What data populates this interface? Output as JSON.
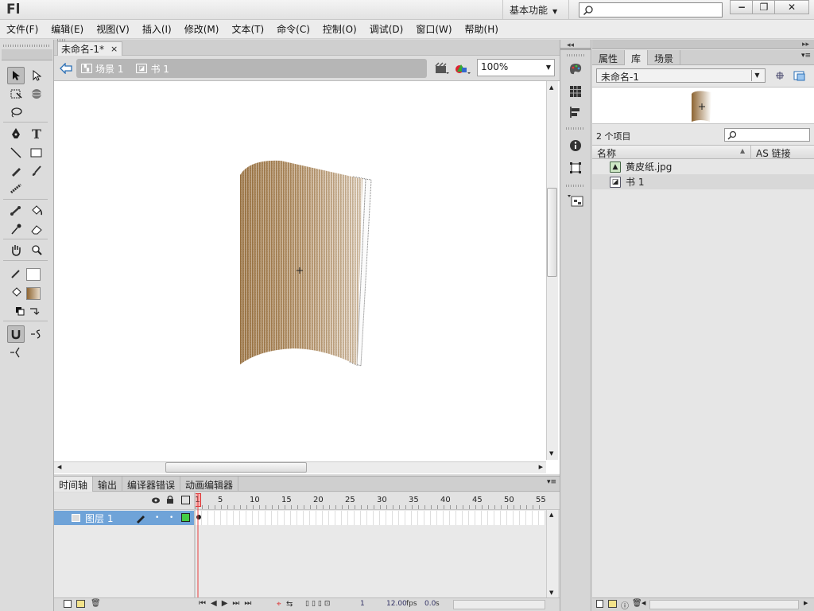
{
  "app": {
    "logo": "Fl",
    "workspace": "基本功能",
    "search_placeholder": ""
  },
  "window": {
    "minimize": "−",
    "restore": "❐",
    "close": "✕"
  },
  "menu": [
    "文件(F)",
    "编辑(E)",
    "视图(V)",
    "插入(I)",
    "修改(M)",
    "文本(T)",
    "命令(C)",
    "控制(O)",
    "调试(D)",
    "窗口(W)",
    "帮助(H)"
  ],
  "document": {
    "tab_title": "未命名-1*",
    "tab_close": "×"
  },
  "breadcrumb": {
    "scene": "场景 1",
    "symbol": "书 1"
  },
  "zoom": {
    "value": "100%"
  },
  "timeline": {
    "tabs": [
      "时间轴",
      "输出",
      "编译器错误",
      "动画编辑器"
    ],
    "frame_numbers": [
      "1",
      "5",
      "10",
      "15",
      "20",
      "25",
      "30",
      "35",
      "40",
      "45",
      "50",
      "55"
    ],
    "layer_name": "图层 1",
    "status": {
      "current_frame": "1",
      "fps": "12.00",
      "fps_unit": "fps",
      "time": "0.0",
      "time_unit": "s"
    }
  },
  "library": {
    "tabs": [
      "属性",
      "库",
      "场景"
    ],
    "document_select": "未命名-1",
    "item_count": "2 个项目",
    "col_name": "名称",
    "col_linkage": "AS 链接",
    "items": [
      {
        "name": "黄皮纸.jpg",
        "icon": "bitmap-icon"
      },
      {
        "name": "书 1",
        "icon": "graphic-symbol-icon"
      }
    ]
  },
  "colors": {
    "accent": "#6fa3d8",
    "paper_dark": "#8d6431",
    "paper_light": "#ffffff",
    "playhead": "#e84040"
  }
}
